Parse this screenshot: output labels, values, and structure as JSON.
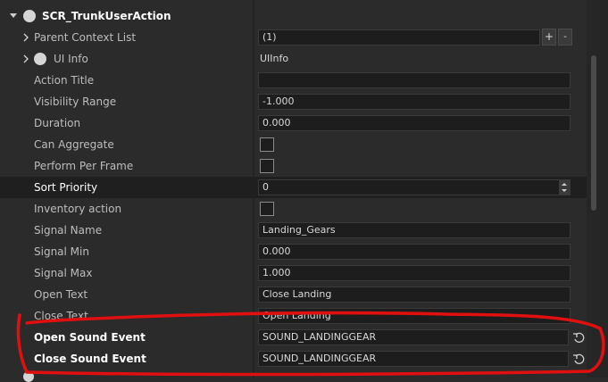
{
  "component": {
    "title": "SCR_TrunkUserAction"
  },
  "properties": [
    {
      "label": "Parent Context List",
      "value": "(1)",
      "plus": "+",
      "extra": "-"
    },
    {
      "label": "UI Info",
      "value": "UIInfo"
    },
    {
      "label": "Action Title",
      "value": ""
    },
    {
      "label": "Visibility Range",
      "value": "-1.000"
    },
    {
      "label": "Duration",
      "value": "0.000"
    },
    {
      "label": "Can Aggregate"
    },
    {
      "label": "Perform Per Frame"
    },
    {
      "label": "Sort  Priority",
      "value": "0"
    },
    {
      "label": "Inventory action"
    },
    {
      "label": "Signal Name",
      "value": "Landing_Gears"
    },
    {
      "label": "Signal Min",
      "value": "0.000"
    },
    {
      "label": "Signal Max",
      "value": "1.000"
    },
    {
      "label": "Open Text",
      "value": "Close Landing"
    },
    {
      "label": "Close Text",
      "value": "Open Landing"
    },
    {
      "label": "Open Sound Event",
      "value": "SOUND_LANDINGGEAR"
    },
    {
      "label": "Close Sound Event",
      "value": "SOUND_LANDINGGEAR"
    }
  ],
  "colors": {
    "background": "#2b2b2b",
    "field": "#1d1d1d",
    "annotation": "#e01010"
  }
}
